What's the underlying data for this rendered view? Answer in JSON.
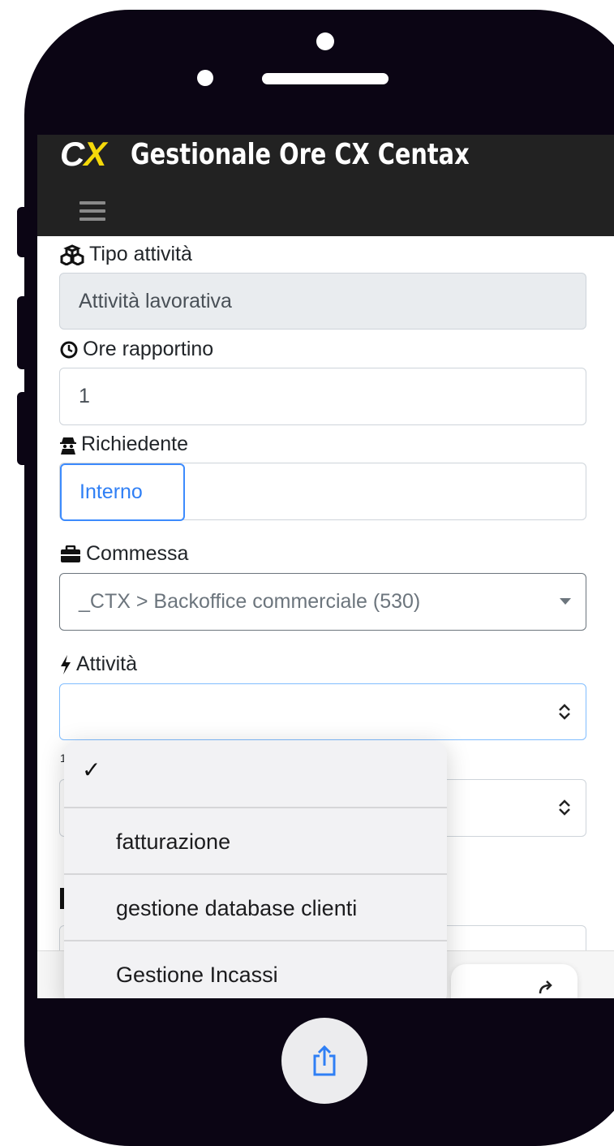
{
  "app": {
    "logo_text_prefix": "C",
    "logo_text_suffix": "X",
    "title": "Gestionale Ore CX Centax"
  },
  "icons": {
    "menu": "hamburger-menu-icon",
    "tipo": "cubes-icon",
    "ore": "clock-icon",
    "richiedente": "user-secret-icon",
    "commessa": "briefcase-icon",
    "attivita": "bolt-icon",
    "share": "share-icon"
  },
  "form": {
    "tipo_label": "Tipo attività",
    "tipo_value": "Attività lavorativa",
    "ore_label": "Ore rapportino",
    "ore_value": "1",
    "richiedente_label": "Richiedente",
    "richiedente_option": "Interno",
    "commessa_label": "Commessa",
    "commessa_value": "_CTX > Backoffice commerciale (530)",
    "attivita_label": "Attività",
    "attivita_value": "",
    "hidden_label_fragment": "1"
  },
  "dropdown": {
    "check": "✓",
    "options": [
      "fatturazione",
      "gestione database clienti",
      "Gestione Incassi"
    ]
  },
  "colors": {
    "topbar": "#222222",
    "logo_accent": "#f5d90a",
    "primary_blue": "#2f7ff5",
    "phone_frame": "#0b0514"
  }
}
